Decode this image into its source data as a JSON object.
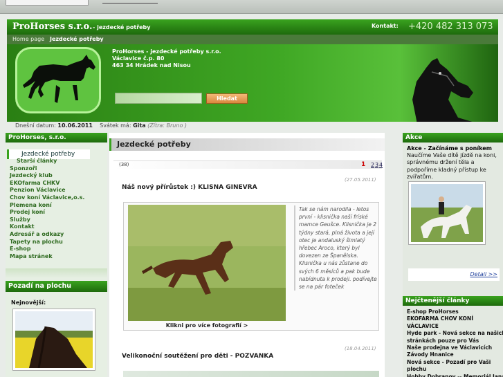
{
  "header": {
    "brand": "ProHorses s.r.o.",
    "brand_sub": "- jezdecké potřeby",
    "contact_label": "Kontakt:",
    "phone": "+420 482 313 073",
    "crumbs": [
      "Home page",
      "Jezdecké potřeby"
    ],
    "address": [
      "ProHorses - jezdecké potřeby s.r.o.",
      "Václavice č.p. 80",
      "463 34 Hrádek nad Nisou"
    ],
    "search_button": "Hledat"
  },
  "dateline": {
    "date_label": "Dnešní datum:",
    "date": "10.06.2011",
    "nameday_label": "Svátek má:",
    "nameday": "Gita",
    "tomorrow": "(Zítra: Bruno )"
  },
  "left": {
    "heading": "ProHorses, s.r.o.",
    "active_item": "Jezdecké potřeby",
    "menu": [
      {
        "label": "Starší články",
        "sub": true
      },
      {
        "label": "Sponzoři",
        "sub": false
      },
      {
        "label": "Jezdecký klub",
        "sub": false
      },
      {
        "label": "EKOfarma CHKV",
        "sub": false
      },
      {
        "label": "Penzion Václavice",
        "sub": false
      },
      {
        "label": "Chov koní Václavice,o.s.",
        "sub": false
      },
      {
        "label": "Plemena koní",
        "sub": false
      },
      {
        "label": "Prodej koní",
        "sub": false
      },
      {
        "label": "Služby",
        "sub": false
      },
      {
        "label": "Kontakt",
        "sub": false
      },
      {
        "label": "Adresář a odkazy",
        "sub": false
      },
      {
        "label": "Tapety na plochu",
        "sub": false
      },
      {
        "label": "E-shop",
        "sub": false
      },
      {
        "label": "Mapa stránek",
        "sub": false
      }
    ],
    "wallpaper_heading": "Pozadí na plochu",
    "newest_label": "Nejnovější:"
  },
  "main": {
    "title": "Jezdecké potřeby",
    "count": "(38)",
    "current_page": "1",
    "pages": [
      "2",
      "3",
      "4"
    ],
    "article1": {
      "date": "(27.05.2011)",
      "title": "Náš nový přírůstek :) KLISNA GINEVRA",
      "caption": "Klikni pro více fotografií >",
      "text": "Tak se nám narodila - letos první - klisnička naší fríské mamce Geušce. Klisnička je 2 týdny stará, plná života a její otec je andaluský šimlatý hřebec Aroco, který byl dovezen ze Španělska. Klisnička u nás zůstane do svých 6 měsíců a pak bude nabídnuta k prodeji. podívejte se na pár foteček"
    },
    "article2": {
      "date": "(18.04.2011)",
      "title": "Velikonoční soutěžení pro děti - POZVANKA"
    }
  },
  "right": {
    "heading": "Akce",
    "akce_title": "Akce - Začínáme s poníkem",
    "akce_text": "Naučíme Vaše dítě jízdě na koni, správnému držení těla a podpoříme kladný přístup ke zvířatům.",
    "detail_link": "Detail >>",
    "recent_heading": "Nejčtenější články",
    "recent": [
      "E-shop ProHorses",
      "EKOFARMA CHOV KONÍ",
      "VÁCLAVICE",
      "Hyde park - Nová sekce na našich",
      "stránkách pouze pro Vás",
      "Naše prodejna ve Václavicích",
      "Závody Hnanice",
      "Nová sekce - Pozadí pro Vaši",
      "plochu",
      "Hobby Dobranov -- Memoriál Jana"
    ]
  }
}
